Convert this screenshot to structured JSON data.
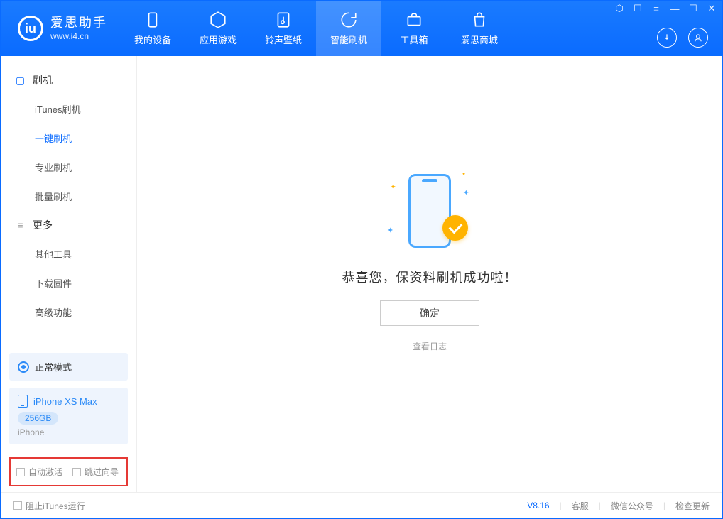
{
  "app": {
    "name": "爱思助手",
    "url": "www.i4.cn"
  },
  "nav": {
    "items": [
      {
        "label": "我的设备"
      },
      {
        "label": "应用游戏"
      },
      {
        "label": "铃声壁纸"
      },
      {
        "label": "智能刷机"
      },
      {
        "label": "工具箱"
      },
      {
        "label": "爱思商城"
      }
    ],
    "active_index": 3
  },
  "sidebar": {
    "group1": "刷机",
    "items1": [
      "iTunes刷机",
      "一键刷机",
      "专业刷机",
      "批量刷机"
    ],
    "active1_index": 1,
    "group2": "更多",
    "items2": [
      "其他工具",
      "下载固件",
      "高级功能"
    ],
    "status": "正常模式",
    "device": {
      "name": "iPhone XS Max",
      "capacity": "256GB",
      "type": "iPhone"
    },
    "options": {
      "auto_activate": "自动激活",
      "skip_guide": "跳过向导"
    }
  },
  "main": {
    "success_msg": "恭喜您，保资料刷机成功啦！",
    "ok": "确定",
    "view_log": "查看日志"
  },
  "footer": {
    "block_itunes": "阻止iTunes运行",
    "version": "V8.16",
    "links": [
      "客服",
      "微信公众号",
      "检查更新"
    ]
  }
}
